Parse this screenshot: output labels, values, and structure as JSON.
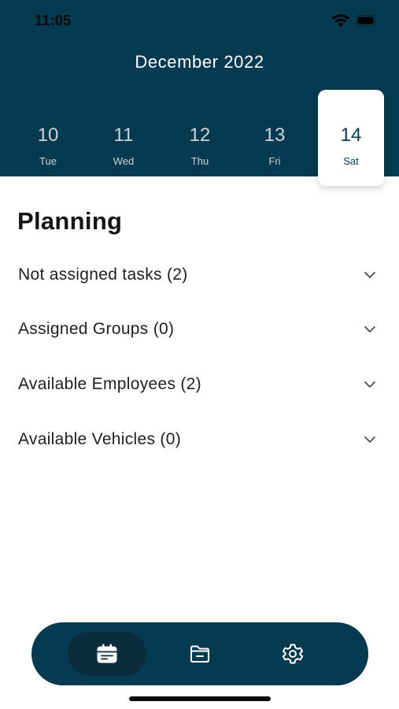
{
  "status_bar": {
    "time": "11:05"
  },
  "calendar": {
    "month_title": "December 2022",
    "days": [
      {
        "number": "10",
        "weekday": "Tue"
      },
      {
        "number": "11",
        "weekday": "Wed"
      },
      {
        "number": "12",
        "weekday": "Thu"
      },
      {
        "number": "13",
        "weekday": "Fri"
      },
      {
        "number": "14",
        "weekday": "Sat",
        "selected": true
      }
    ]
  },
  "planning": {
    "title": "Planning",
    "sections": [
      {
        "label": "Not assigned tasks (2)"
      },
      {
        "label": "Assigned Groups (0)"
      },
      {
        "label": "Available Employees (2)"
      },
      {
        "label": "Available Vehicles (0)"
      }
    ]
  },
  "tab_bar": {
    "tabs": [
      {
        "icon": "calendar-icon",
        "active": true
      },
      {
        "icon": "folder-icon",
        "active": false
      },
      {
        "icon": "gear-icon",
        "active": false
      }
    ]
  },
  "colors": {
    "header_bg": "#063a51",
    "tab_bar_bg": "#063a51",
    "active_tab_bg": "#0a2c3d",
    "selected_day_text": "#063a51"
  }
}
